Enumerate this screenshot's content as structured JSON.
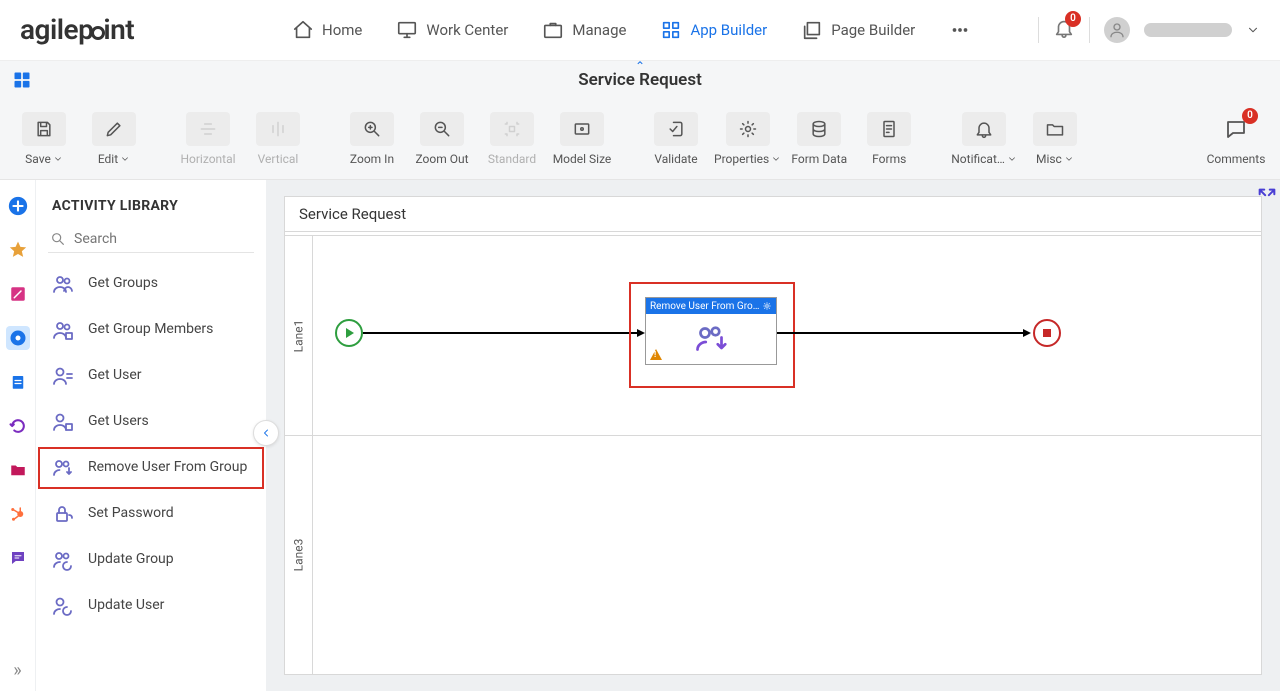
{
  "header": {
    "logo_text_before_dot": "agilep",
    "logo_text_after_dot": "int",
    "nav": [
      {
        "label": "Home"
      },
      {
        "label": "Work Center"
      },
      {
        "label": "Manage"
      },
      {
        "label": "App Builder"
      },
      {
        "label": "Page Builder"
      }
    ],
    "notification_count": "0"
  },
  "title_bar": {
    "title": "Service Request"
  },
  "toolbar": {
    "save": "Save",
    "edit": "Edit",
    "horizontal": "Horizontal",
    "vertical": "Vertical",
    "zoom_in": "Zoom In",
    "zoom_out": "Zoom Out",
    "standard": "Standard",
    "model_size": "Model Size",
    "validate": "Validate",
    "properties": "Properties",
    "form_data": "Form Data",
    "forms": "Forms",
    "notifications": "Notificat…",
    "misc": "Misc",
    "comments": "Comments",
    "comments_count": "0"
  },
  "library": {
    "title": "ACTIVITY LIBRARY",
    "search_placeholder": "Search",
    "items": [
      "Get Groups",
      "Get Group Members",
      "Get User",
      "Get Users",
      "Remove User From Group",
      "Set Password",
      "Update Group",
      "Update User"
    ]
  },
  "canvas": {
    "title": "Service Request",
    "lanes": [
      "Lane1",
      "Lane3"
    ],
    "activity_label": "Remove User From Gro…"
  }
}
